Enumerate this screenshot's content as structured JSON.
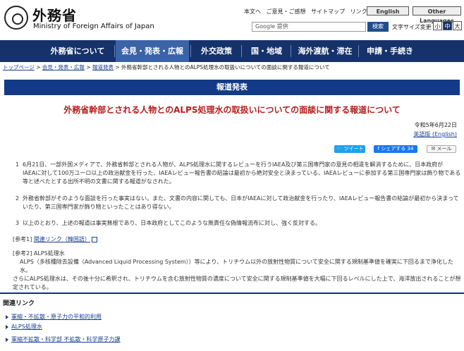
{
  "header": {
    "site_name_ja": "外務省",
    "site_name_en": "Ministry of Foreign Affairs of Japan",
    "top_links": [
      "本文へ",
      "ご意見・ご感想",
      "サイトマップ",
      "リンク集"
    ],
    "english_label": "English",
    "other_languages_label": "Other Languages",
    "search_placeholder": "Google 提供",
    "search_button": "検索",
    "font_size_label": "文字サイズ変更",
    "font_sizes": [
      "小",
      "中",
      "大"
    ]
  },
  "nav": {
    "items": [
      "外務省について",
      "会見・発表・広報",
      "外交政策",
      "国・地域",
      "海外渡航・滞在",
      "申請・手続き"
    ]
  },
  "breadcrumb": {
    "items": [
      "トップページ",
      "会見・発表・広報",
      "報道発表"
    ],
    "current": "外務省幹部とされる人物とのALPS処理水の取扱いについての面談に関する報道について"
  },
  "banner": "報道発表",
  "title": "外務省幹部とされる人物とのALPS処理水の取扱いについての面談に関する報道について",
  "date": "令和5年6月22日",
  "english_version": "英語版 (English)",
  "share": {
    "tweet": "ツイート",
    "facebook": "シェアする 34",
    "mail": "メール"
  },
  "paragraphs": [
    {
      "num": "1",
      "lines": [
        "6月21日、一部外国メディアで、外務省幹部とされる人物が、ALPS処理水に関するレビューを行うIAEA及び第三国専門家の意見の相違を解消するために、日本政府が",
        "IAEAに対して100万ユーロ以上の政治献金を行った、IAEAレビュー報告書の結論は最初から絶対安全と決まっている、IAEAレビューに参加する第三国専門家は飾り物である",
        "等と述べたとする出所不明の文書に関する報道がなされた。"
      ]
    },
    {
      "num": "2",
      "lines": [
        "外務省幹部がそのような面談を行った事実はない。また、文書の内容に関しても、日本がIAEAに対して政治献金を行ったり、IAEAレビュー報告書の結論が最初から決まって",
        "いたり、第三国専門家が飾り物といったことはあり得ない。"
      ]
    },
    {
      "num": "3",
      "lines": [
        "以上のとおり、上述の報道は事実無根であり、日本政府としてこのような無責任な偽情報流布に対し、強く反対する。"
      ]
    }
  ],
  "ref1": {
    "label": "[参考1]",
    "link": "関連リンク（韓国語）"
  },
  "ref2": {
    "label": "[参考2] ALPS処理水",
    "lines": [
      "ALPS（多核種除去設備（Advanced Liquid Processing System））等により、トリチウム以外の放射性物質について安全に関する規制基準値を確実に下回るまで浄化した水。",
      "さらにALPS処理水は、その後十分に希釈され、トリチウムを含む放射性物質の濃度について安全に関する規制基準値を大幅に下回るレベルにした上で、海洋放出されることが想",
      "定されている。"
    ]
  },
  "related": {
    "heading": "関連リンク",
    "items": [
      "軍縮・不拡散・原子力の平和的利用",
      "ALPS処理水",
      "軍縮不拡散・科学部 不拡散・科学原子力課"
    ]
  },
  "colors": {
    "nav": "#15326b",
    "banner": "#123a86",
    "title": "#b71c1c"
  }
}
